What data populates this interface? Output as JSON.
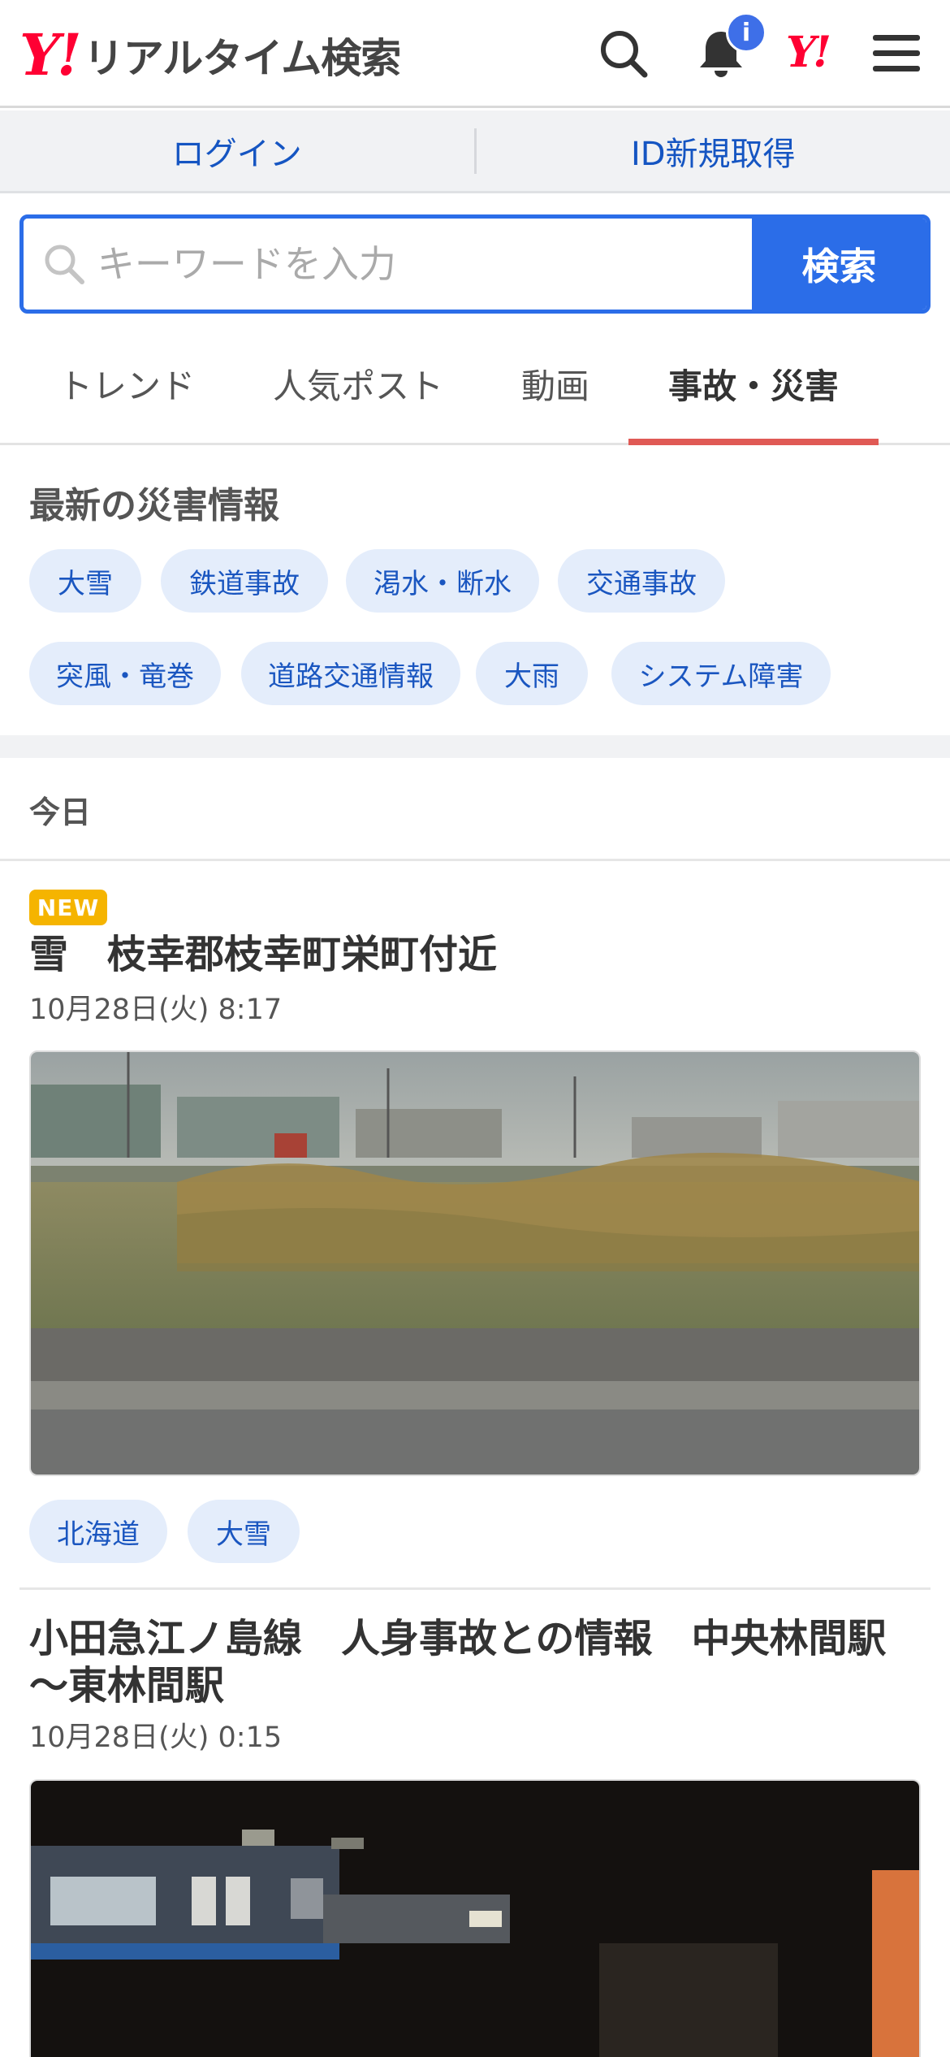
{
  "header": {
    "logo_y": "Y!",
    "logo_text": "リアルタイム検索",
    "notification_badge": "i",
    "yahoo_small_logo": "Y!"
  },
  "login_bar": {
    "login": "ログイン",
    "register": "ID新規取得"
  },
  "search": {
    "placeholder": "キーワードを入力",
    "button": "検索"
  },
  "tabs": [
    {
      "label": "トレンド",
      "active": false
    },
    {
      "label": "人気ポスト",
      "active": false
    },
    {
      "label": "動画",
      "active": false
    },
    {
      "label": "事故・災害",
      "active": true
    }
  ],
  "disaster": {
    "title": "最新の災害情報",
    "chips": [
      "大雪",
      "鉄道事故",
      "渇水・断水",
      "交通事故",
      "突風・竜巻",
      "道路交通情報",
      "大雨",
      "システム障害"
    ]
  },
  "day_label": "今日",
  "articles": [
    {
      "badge": "NEW",
      "title": "雪　枝幸郡枝幸町栄町付近",
      "date": "10月28日(火) 8:17",
      "tags": [
        "北海道",
        "大雪"
      ]
    },
    {
      "title": "小田急江ノ島線　人身事故との情報　中央林間駅～東林間駅",
      "date": "10月28日(火) 0:15"
    }
  ],
  "colors": {
    "accent_blue": "#2b6de8",
    "brand_red": "#ff0033",
    "tab_underline": "#e05a55",
    "chip_bg": "#e4edfb",
    "new_badge": "#f5b400"
  }
}
